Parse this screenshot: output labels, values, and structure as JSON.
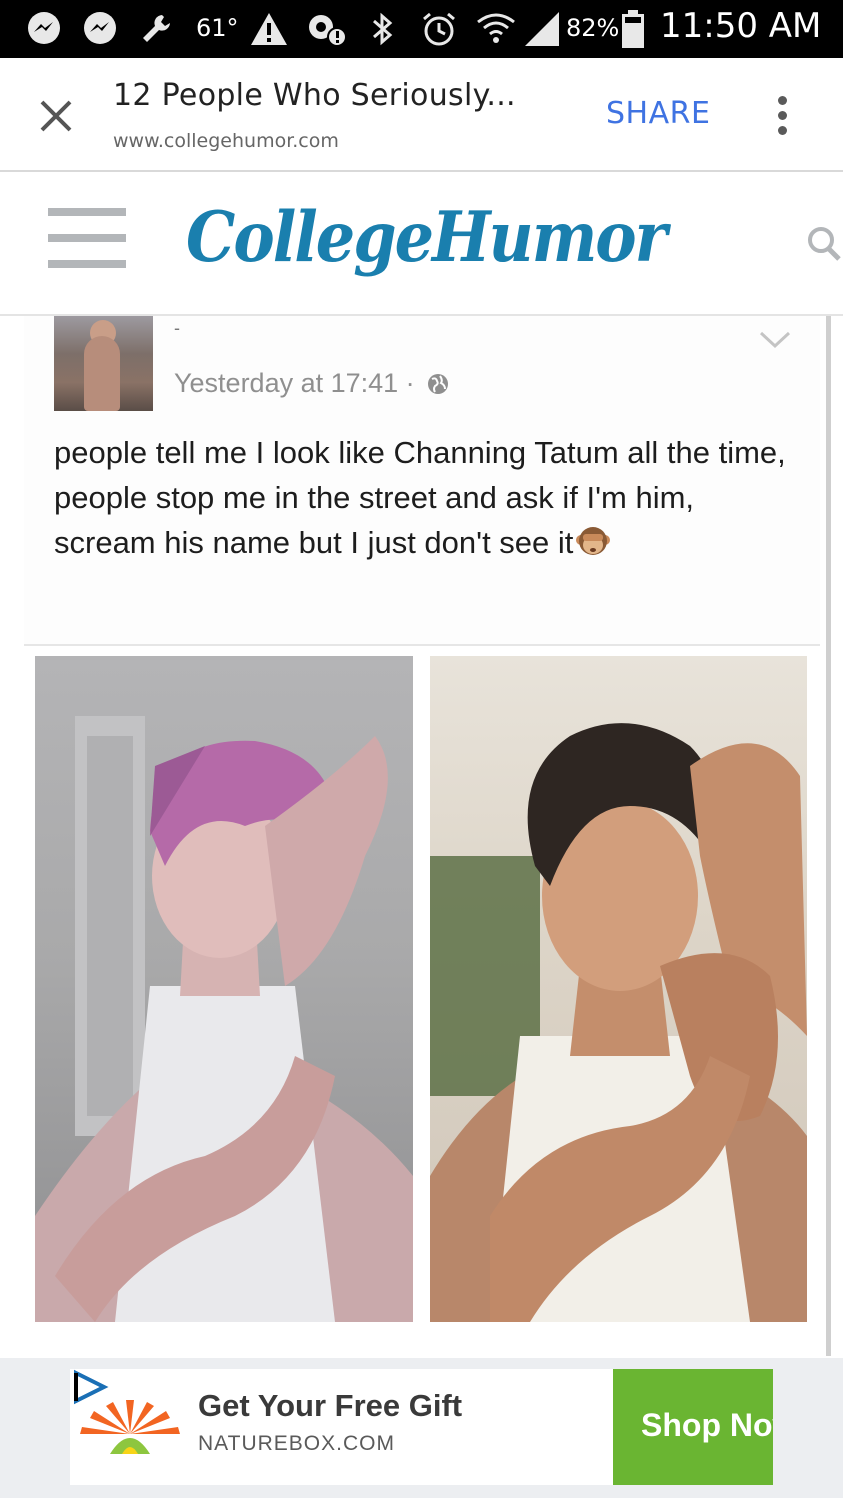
{
  "status_bar": {
    "temperature": "61°",
    "battery": "82%",
    "time": "11:50 AM",
    "icons": [
      "messenger-icon",
      "messenger-icon",
      "wrench-icon",
      "temperature-label",
      "warning-icon",
      "security-icon",
      "bluetooth-icon",
      "alarm-icon",
      "wifi-icon",
      "signal-icon",
      "battery-icon"
    ]
  },
  "browser_tab": {
    "title": "12 People Who Seriously...",
    "url": "www.collegehumor.com",
    "share_label": "SHARE",
    "close_icon": "close-icon",
    "menu_icon": "more-vert-icon"
  },
  "site_header": {
    "logo_text": "CollegeHumor",
    "logo_color": "#1a7fae",
    "menu_icon": "hamburger-icon",
    "search_icon": "search-icon"
  },
  "post": {
    "author_name": "-",
    "timestamp": "Yesterday at 17:41 ·",
    "privacy_icon": "globe-icon",
    "body": "people tell me I look like Channing Tatum all the time, people stop me in the street and ask if I'm him, scream his name but I just don't see it",
    "emoji": "see-no-evil-monkey-icon"
  },
  "ad": {
    "title": "Get Your Free Gift",
    "domain": "NATUREBOX.COM",
    "cta_label": "Shop Now",
    "cta_color": "#6ab532",
    "adchoices_icon": "adchoices-icon",
    "brand_icon": "naturebox-sun-icon"
  },
  "colors": {
    "share": "#3f73e2",
    "status_bar_bg": "#000000"
  }
}
